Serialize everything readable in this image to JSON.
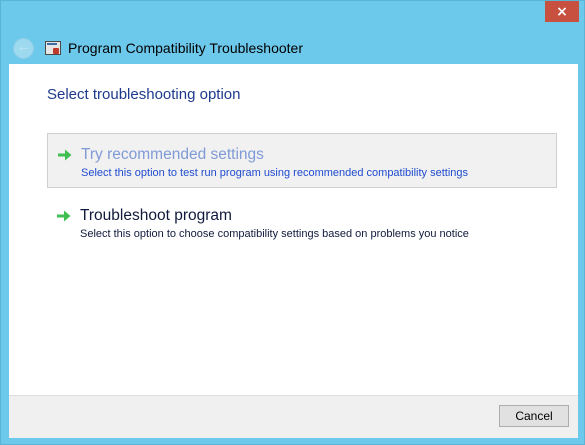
{
  "window": {
    "title": "Program Compatibility Troubleshooter",
    "close_glyph": "×",
    "back_icon": "back-arrow-icon",
    "app_icon": "program-compatibility-icon"
  },
  "main": {
    "heading": "Select troubleshooting option",
    "options": [
      {
        "title": "Try recommended settings",
        "description": "Select this option to test run program using recommended compatibility settings",
        "icon": "green-arrow-icon",
        "state": "hovered"
      },
      {
        "title": "Troubleshoot program",
        "description": "Select this option to choose compatibility settings based on problems you notice",
        "icon": "green-arrow-icon",
        "state": "normal"
      }
    ]
  },
  "footer": {
    "cancel_label": "Cancel"
  },
  "colors": {
    "frame": "#6cc9ec",
    "close_button": "#c7503f",
    "heading_text": "#1d3a8c",
    "arrow_green": "#3fbf4f"
  }
}
